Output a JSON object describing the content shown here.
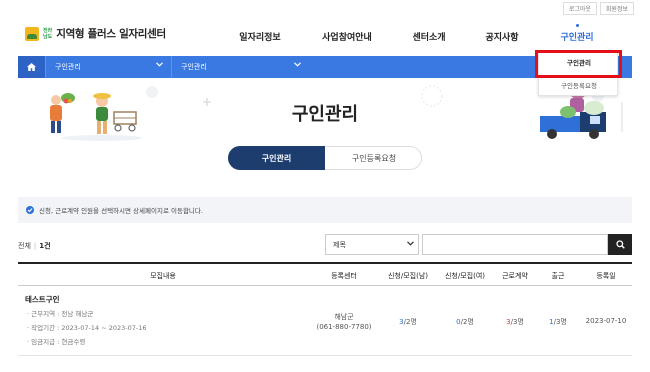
{
  "util": {
    "logout": "로그아웃",
    "member": "회원정보"
  },
  "logo": {
    "sub1": "전라",
    "sub2": "남도",
    "text": "지역형 플러스 일자리센터"
  },
  "gnb": [
    "일자리정보",
    "사업참여안내",
    "센터소개",
    "공지사항",
    "구인관리"
  ],
  "navbar": {
    "sel1": "구인관리",
    "sel2": "구인관리"
  },
  "dropdown": {
    "item1": "구인관리",
    "item2": "구인등록요청"
  },
  "page": {
    "title": "구인관리"
  },
  "tabs": {
    "tab1": "구인관리",
    "tab2": "구인등록요청"
  },
  "info": {
    "text": "신청, 근로계약 인원을 선택하시면 상세페이지로 이동합니다."
  },
  "count": {
    "label": "전체",
    "value": "1건"
  },
  "search": {
    "select": "제목",
    "placeholder": ""
  },
  "table": {
    "headers": [
      "모집내용",
      "등록센터",
      "신청/모집(남)",
      "신청/모집(여)",
      "근로계약",
      "출근",
      "등록일"
    ],
    "row": {
      "title": "테스트구인",
      "area": "· 근무지역 : 전남 해남군",
      "period": "· 작업기간 : 2023-07-14 ~ 2023-07-16",
      "pay": "· 임금지급 : 현금수령",
      "center": "해남군",
      "phone": "(061-880-7780)",
      "male_app": "3",
      "male_total": "/2명",
      "female_app": "0",
      "female_total": "/2명",
      "contract_app": "3",
      "contract_total": "/3명",
      "attend_app": "1",
      "attend_total": "/3명",
      "date": "2023-07-10"
    }
  },
  "colors": {
    "primary": "#3a79e2",
    "navy": "#1e3d6f",
    "accent": "#2e6fd8",
    "highlight": "#e3101a"
  }
}
